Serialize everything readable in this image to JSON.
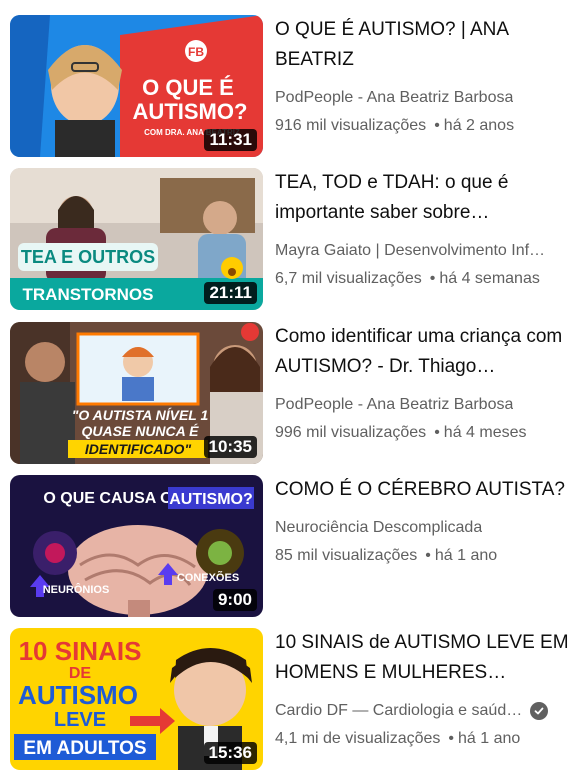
{
  "videos": [
    {
      "title": "O QUE É AUTISMO? | ANA BEATRIZ",
      "channel": "PodPeople - Ana Beatriz Barbosa",
      "views": "916 mil visualizações",
      "age": "há 2 anos",
      "duration": "11:31",
      "thumb_text": {
        "badge": "FB",
        "line1": "O QUE É",
        "line2": "AUTISMO?",
        "line3": "COM DRA. ANA BEATRIZ"
      },
      "verified": false
    },
    {
      "title": "TEA, TOD e TDAH: o que é importante saber sobre…",
      "channel": "Mayra Gaiato | Desenvolvimento Inf…",
      "views": "6,7 mil visualizações",
      "age": "há 4 semanas",
      "duration": "21:11",
      "thumb_text": {
        "line1": "TEA E OUTROS",
        "line2": "TRANSTORNOS"
      },
      "verified": false
    },
    {
      "title": "Como identificar uma criança com AUTISMO? - Dr. Thiago…",
      "channel": "PodPeople - Ana Beatriz Barbosa",
      "views": "996 mil visualizações",
      "age": "há 4 meses",
      "duration": "10:35",
      "thumb_text": {
        "line1": "\"O AUTISTA NÍVEL 1",
        "line2": "QUASE NUNCA É",
        "line3": "IDENTIFICADO\""
      },
      "verified": false
    },
    {
      "title": "COMO É O CÉREBRO AUTISTA?",
      "channel": "Neurociência Descomplicada",
      "views": "85 mil visualizações",
      "age": "há 1 ano",
      "duration": "9:00",
      "thumb_text": {
        "line1": "O QUE CAUSA O",
        "line2": "AUTISMO?",
        "left_label": "NEURÔNIOS",
        "right_label": "CONEXÕES"
      },
      "verified": false
    },
    {
      "title": "10 SINAIS de AUTISMO LEVE EM HOMENS E MULHERES…",
      "channel": "Cardio DF — Cardiologia e saúd…",
      "views": "4,1 mi de visualizações",
      "age": "há 1 ano",
      "duration": "15:36",
      "thumb_text": {
        "line1": "10 SINAIS",
        "line2": "DE",
        "line3": "AUTISMO",
        "line4": "LEVE",
        "line5": "EM ADULTOS"
      },
      "verified": true
    }
  ],
  "separator": "•",
  "colors": {
    "title": "#0f0f0f",
    "meta": "#606060",
    "thumb1_bg": "#1e88e5",
    "thumb2_bg": "#0aa89e",
    "thumb3_bg": "#8b5a3c",
    "thumb4_bg": "#1a1240",
    "thumb5_bg": "#ffd400"
  }
}
